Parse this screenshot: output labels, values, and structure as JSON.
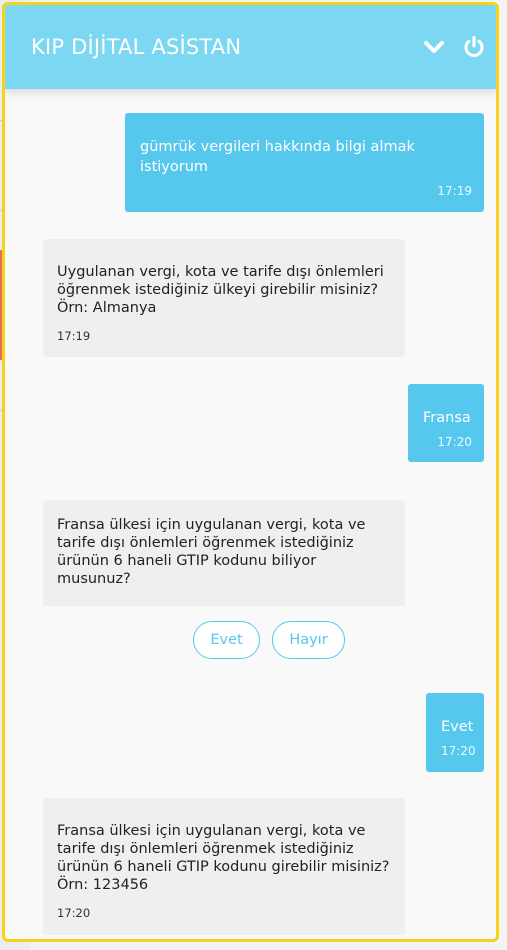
{
  "header": {
    "title": "KIP DİJİTAL ASİSTAN",
    "icons": [
      "chevron-down-icon",
      "power-icon"
    ]
  },
  "colors": {
    "header": "#7cd8f2",
    "user_bubble": "#56c7ed",
    "bot_bubble": "#efefef",
    "frame_border": "#f6d21a"
  },
  "messages": [
    {
      "from": "user",
      "text": "gümrük vergileri hakkında bilgi almak istiyorum",
      "time": "17:19"
    },
    {
      "from": "bot",
      "text": "Uygulanan vergi, kota ve tarife dışı önlemleri öğrenmek istediğiniz ülkeyi girebilir misiniz? Örn: Almanya",
      "time": "17:19"
    },
    {
      "from": "user",
      "text": "Fransa",
      "time": "17:20"
    },
    {
      "from": "bot",
      "text": "Fransa ülkesi için uygulanan vergi, kota ve tarife dışı önlemleri öğrenmek istediğiniz ürünün 6 haneli GTIP kodunu biliyor musunuz?",
      "time": ""
    },
    {
      "from": "user",
      "text": "Evet",
      "time": "17:20"
    },
    {
      "from": "bot",
      "text": "Fransa ülkesi için uygulanan vergi, kota ve tarife dışı önlemleri öğrenmek istediğiniz ürünün 6 haneli GTIP kodunu girebilir misiniz? Örn: 123456",
      "time": "17:20"
    }
  ],
  "quick_replies": [
    "Evet",
    "Hayır"
  ]
}
